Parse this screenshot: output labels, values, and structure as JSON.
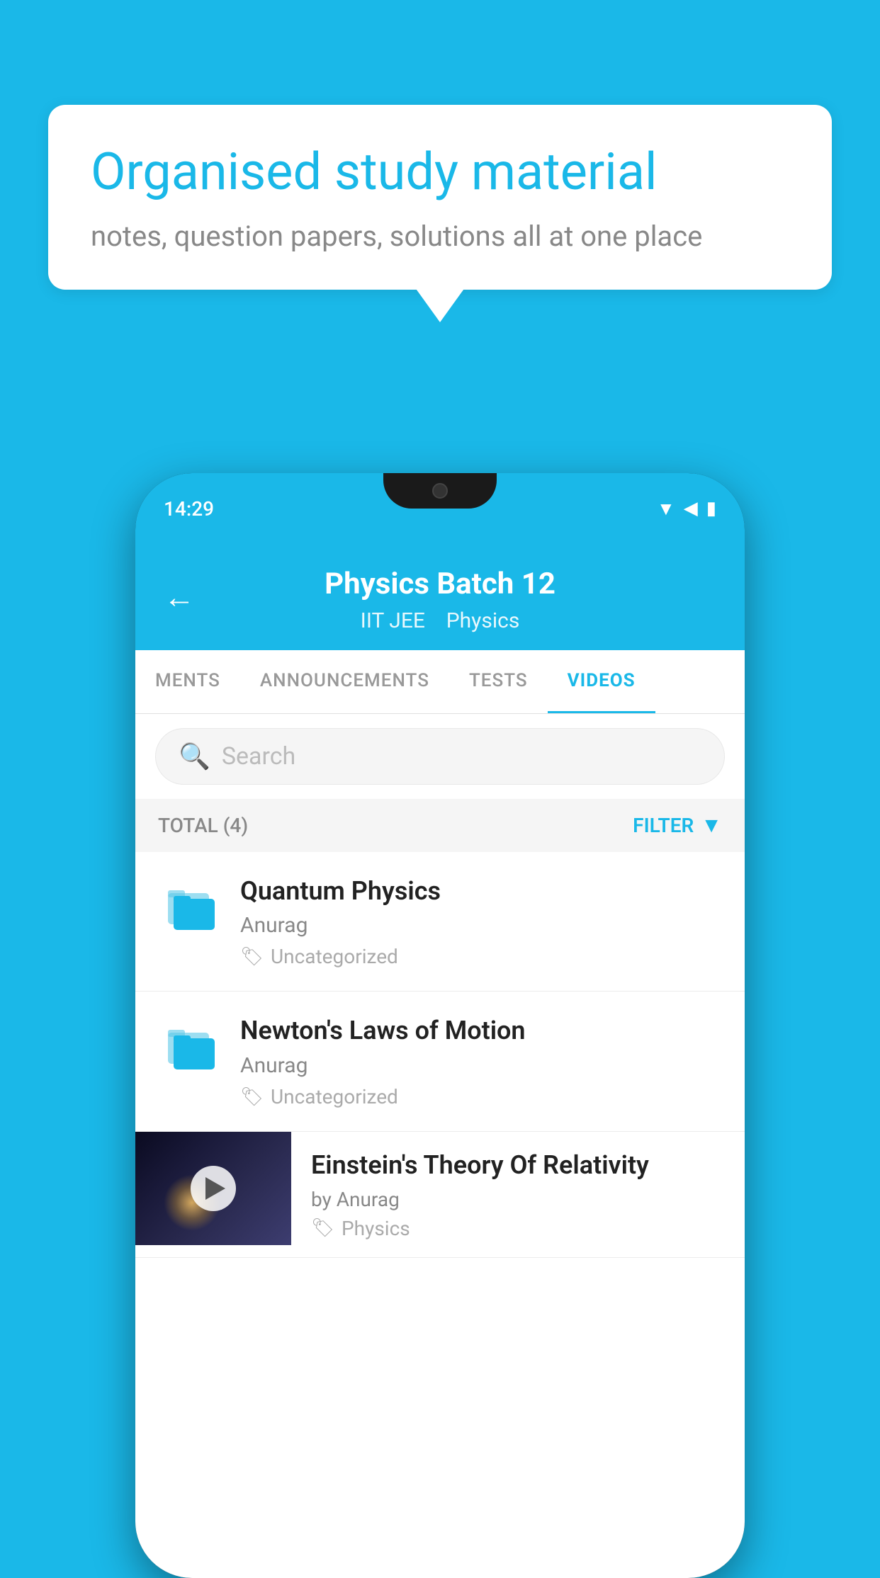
{
  "background": {
    "color": "#1ab8e8"
  },
  "speech_bubble": {
    "title": "Organised study material",
    "subtitle": "notes, question papers, solutions all at one place"
  },
  "phone": {
    "status_bar": {
      "time": "14:29",
      "icons": [
        "wifi",
        "signal",
        "battery"
      ]
    },
    "app_header": {
      "back_label": "←",
      "title": "Physics Batch 12",
      "subtitle_part1": "IIT JEE",
      "subtitle_part2": "Physics"
    },
    "tabs": [
      {
        "label": "MENTS",
        "active": false
      },
      {
        "label": "ANNOUNCEMENTS",
        "active": false
      },
      {
        "label": "TESTS",
        "active": false
      },
      {
        "label": "VIDEOS",
        "active": true
      }
    ],
    "search": {
      "placeholder": "Search"
    },
    "filter_bar": {
      "total_label": "TOTAL (4)",
      "filter_label": "FILTER"
    },
    "video_list": [
      {
        "id": 1,
        "type": "folder",
        "title": "Quantum Physics",
        "author": "Anurag",
        "tag": "Uncategorized"
      },
      {
        "id": 2,
        "type": "folder",
        "title": "Newton's Laws of Motion",
        "author": "Anurag",
        "tag": "Uncategorized"
      },
      {
        "id": 3,
        "type": "video",
        "title": "Einstein's Theory Of Relativity",
        "author": "by Anurag",
        "tag": "Physics"
      }
    ]
  }
}
